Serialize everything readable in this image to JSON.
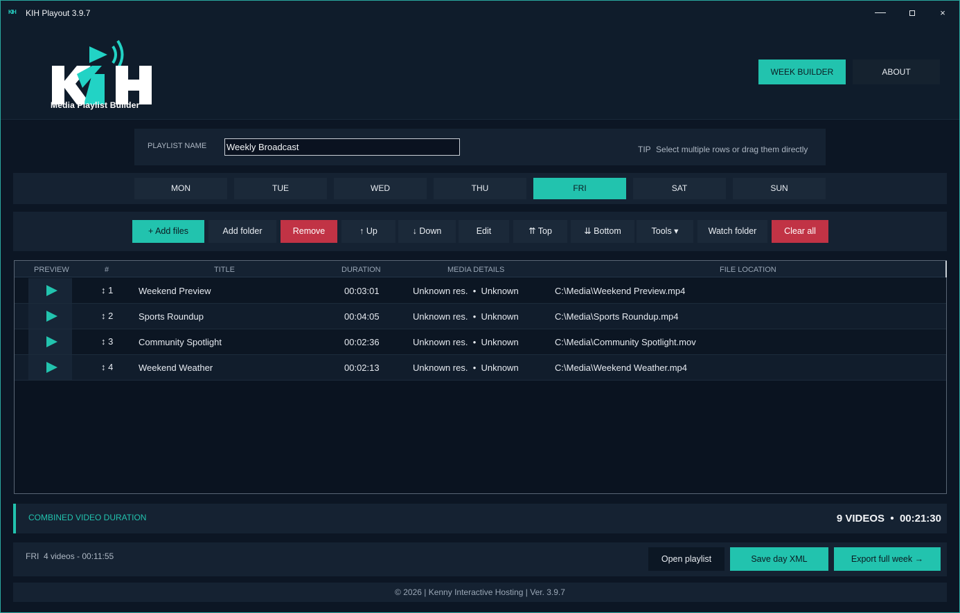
{
  "window": {
    "title": "KIH Playout 3.9.7",
    "icon_text": "KIH",
    "controls": {
      "minimize": "minimize-icon",
      "maximize": "maximize-icon",
      "close": "×"
    }
  },
  "header": {
    "logo_text": "KIH",
    "logo_subtitle": "Media Playlist Builder",
    "nav": {
      "week_builder": "WEEK BUILDER",
      "about": "ABOUT"
    }
  },
  "playlist": {
    "label": "PLAYLIST NAME",
    "value": "Weekly Broadcast",
    "tip_label": "TIP",
    "tip_text": "Select multiple rows or drag them directly"
  },
  "days": [
    "MON",
    "TUE",
    "WED",
    "THU",
    "FRI",
    "SAT",
    "SUN"
  ],
  "active_day": "FRI",
  "toolbar": {
    "add_files": "+ Add files",
    "add_folder": "Add folder",
    "remove": "Remove",
    "up": "↑ Up",
    "down": "↓ Down",
    "edit": "Edit",
    "top": "⇈ Top",
    "bottom": "⇊ Bottom",
    "tools": "Tools ▾",
    "watch_folder": "Watch folder",
    "clear_all": "Clear all"
  },
  "table": {
    "columns": [
      "PREVIEW",
      "#",
      "TITLE",
      "DURATION",
      "MEDIA DETAILS",
      "FILE LOCATION"
    ],
    "rows": [
      {
        "num": "1",
        "title": "Weekend Preview",
        "duration": "00:03:01",
        "details": "Unknown res.  •  Unknown",
        "location": "C:\\Media\\Weekend Preview.mp4"
      },
      {
        "num": "2",
        "title": "Sports Roundup",
        "duration": "00:04:05",
        "details": "Unknown res.  •  Unknown",
        "location": "C:\\Media\\Sports Roundup.mp4"
      },
      {
        "num": "3",
        "title": "Community Spotlight",
        "duration": "00:02:36",
        "details": "Unknown res.  •  Unknown",
        "location": "C:\\Media\\Community Spotlight.mov"
      },
      {
        "num": "4",
        "title": "Weekend Weather",
        "duration": "00:02:13",
        "details": "Unknown res.  •  Unknown",
        "location": "C:\\Media\\Weekend Weather.mp4"
      }
    ]
  },
  "summary": {
    "label": "COMBINED VIDEO DURATION",
    "value": "9 VIDEOS  •  00:21:30"
  },
  "footer": {
    "status": "FRI  4 videos - 00:11:55",
    "open_playlist": "Open playlist",
    "save_day_xml": "Save day XML",
    "export_week": "Export full week →"
  },
  "copyright": "© 2026 | Kenny Interactive Hosting | Ver. 3.9.7",
  "colors": {
    "accent": "#22c3ae",
    "danger": "#c13345",
    "background": "#0c1624",
    "panel": "#152232"
  }
}
